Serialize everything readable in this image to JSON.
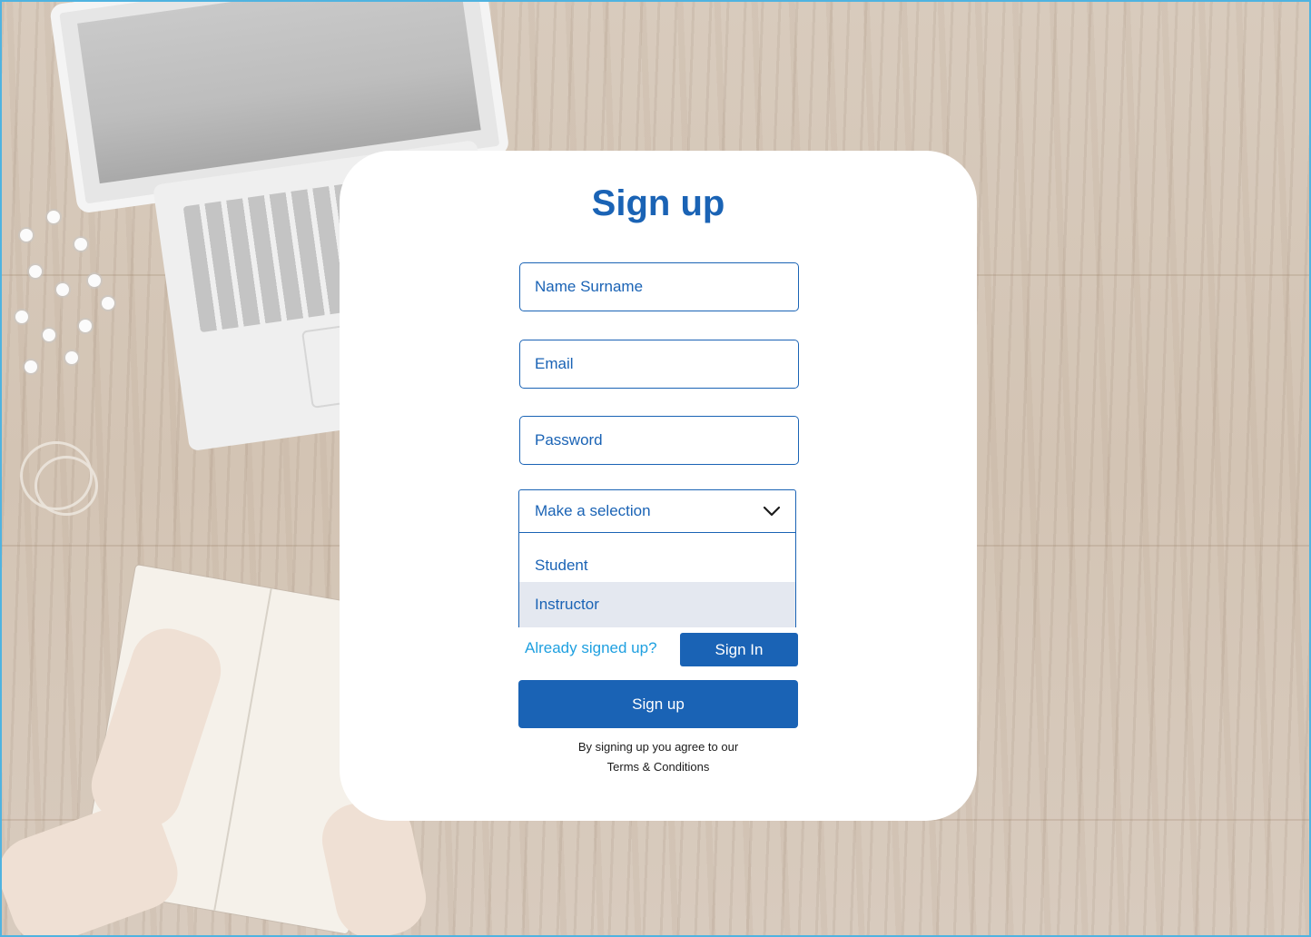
{
  "page": {
    "colors": {
      "accent": "#1a63b5",
      "link": "#1fa0e0",
      "frame": "#4fb3e0",
      "option_highlight": "#e4e8f0"
    }
  },
  "form": {
    "title": "Sign up",
    "name_placeholder": "Name Surname",
    "email_placeholder": "Email",
    "password_placeholder": "Password",
    "role_select": {
      "selected_label": "Make a selection",
      "options": [
        "Student",
        "Instructor"
      ],
      "highlighted_option": "Instructor"
    },
    "already_signed_up": "Already signed up?",
    "sign_in_label": "Sign In",
    "sign_up_label": "Sign up",
    "agreement_text": "By signing up you agree to our",
    "terms_link": "Terms & Conditions"
  },
  "icons": {
    "dropdown": "chevron-down-icon"
  }
}
